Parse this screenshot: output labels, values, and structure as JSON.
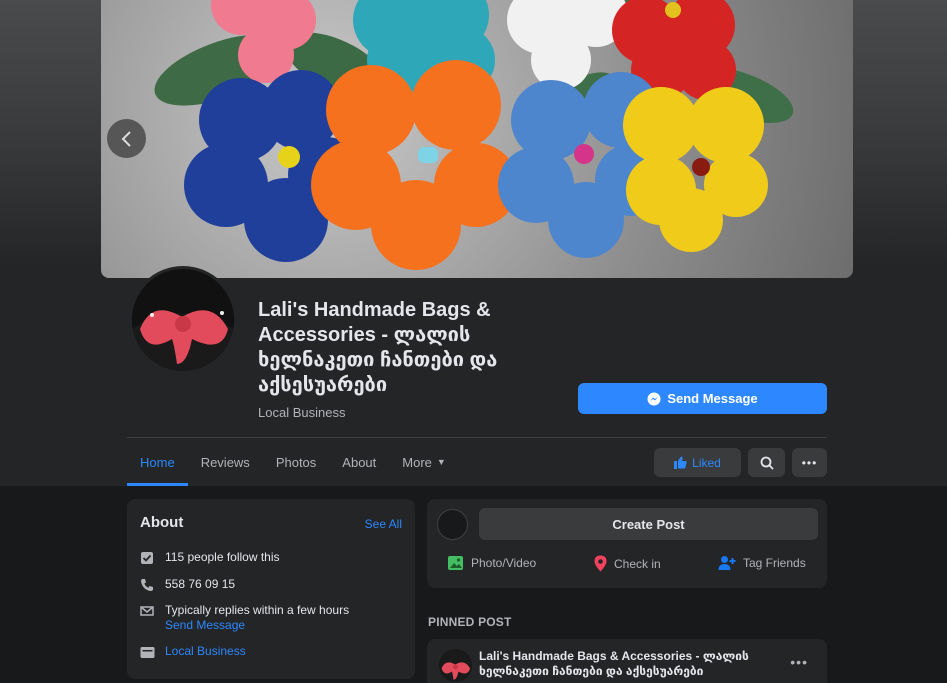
{
  "cover": {
    "prev_icon": "chevron-left-icon"
  },
  "page": {
    "title": "Lali's Handmade Bags & Accessories - ლალის ხელნაკეთი ჩანთები და აქსესუარები",
    "category": "Local Business"
  },
  "actions": {
    "send_message": "Send Message",
    "liked": "Liked"
  },
  "tabs": [
    {
      "label": "Home",
      "active": true
    },
    {
      "label": "Reviews"
    },
    {
      "label": "Photos"
    },
    {
      "label": "About"
    },
    {
      "label": "More"
    }
  ],
  "about": {
    "heading": "About",
    "see_all": "See All",
    "followers": "115 people follow this",
    "phone": "558 76 09 15",
    "replies": "Typically replies within a few hours",
    "replies_link": "Send Message",
    "category_link": "Local Business"
  },
  "create_post": {
    "button": "Create Post",
    "photo_video": "Photo/Video",
    "check_in": "Check in",
    "tag_friends": "Tag Friends"
  },
  "pinned": {
    "label": "PINNED POST",
    "author": "Lali's Handmade Bags & Accessories - ლალის ხელნაკეთი ჩანთები და აქსესუარები"
  },
  "colors": {
    "accent": "#2d88ff",
    "background": "#18191a",
    "card": "#242526"
  }
}
